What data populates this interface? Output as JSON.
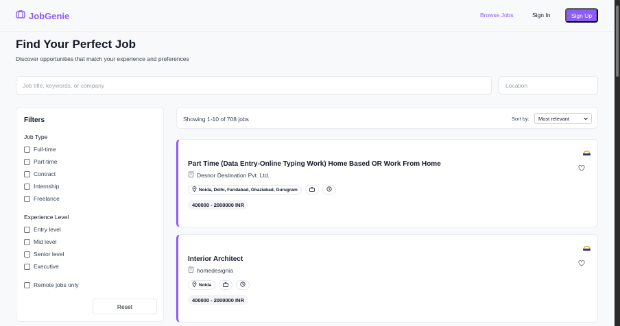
{
  "nav": {
    "brand": "JobGenie",
    "browse_jobs": "Browse Jobs",
    "sign_in": "Sign In",
    "sign_up": "Sign Up",
    "brand_color": "#8b5cf6"
  },
  "hero": {
    "title": "Find Your Perfect Job",
    "subtitle": "Discover opportunities that match your experience and preferences"
  },
  "search": {
    "keyword_placeholder": "Job title, keywords, or company",
    "location_placeholder": "Location"
  },
  "filters": {
    "title": "Filters",
    "job_type_title": "Job Type",
    "job_types": [
      "Full-time",
      "Part-time",
      "Contract",
      "Internship",
      "Freelance"
    ],
    "experience_title": "Experience Level",
    "experience_levels": [
      "Entry level",
      "Mid level",
      "Senior level",
      "Executive"
    ],
    "remote_label": "Remote jobs only",
    "reset": "Reset"
  },
  "results": {
    "count_text": "Showing 1-10 of 708 jobs",
    "sort_label": "Sort by:",
    "sort_value": "Most relevant"
  },
  "jobs": [
    {
      "title": "Part Time (Data Entry-Online Typing Work) Home Based OR Work From Home",
      "company": "Desnor Destination Pvt. Ltd.",
      "location": "Noida, Delhi, Faridabad, Ghaziabad, Gurugram",
      "salary": "400000 - 2000000 INR",
      "icons": [
        "map-pin-icon",
        "briefcase-icon",
        "clock-icon",
        "heart-icon",
        "building-icon"
      ]
    },
    {
      "title": "Interior Architect",
      "company": "homedesignia",
      "location": "Noida",
      "salary": "400000 - 2000000 INR",
      "icons": [
        "map-pin-icon",
        "briefcase-icon",
        "clock-icon",
        "heart-icon",
        "building-icon"
      ]
    }
  ]
}
